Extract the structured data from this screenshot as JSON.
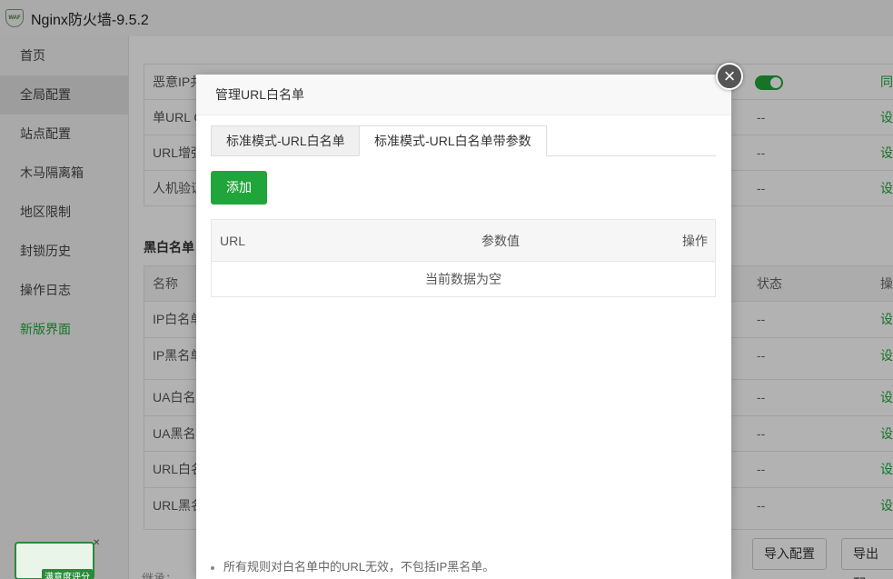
{
  "app": {
    "title": "Nginx防火墙-9.5.2",
    "logo_text": "WAF"
  },
  "sidebar": {
    "items": [
      {
        "label": "首页"
      },
      {
        "label": "全局配置"
      },
      {
        "label": "站点配置"
      },
      {
        "label": "木马隔离箱"
      },
      {
        "label": "地区限制"
      },
      {
        "label": "封锁历史"
      },
      {
        "label": "操作日志"
      },
      {
        "label": "新版界面"
      }
    ]
  },
  "background": {
    "rows_top": [
      {
        "name": "恶意IP共",
        "status": "",
        "op": "同"
      },
      {
        "name": "单URL C",
        "status": "--",
        "op": "设"
      },
      {
        "name": "URL增强",
        "status": "--",
        "op": "设"
      },
      {
        "name": "人机验证",
        "status": "--",
        "op": "设"
      }
    ],
    "section": "黑白名单",
    "list_header": {
      "name": "名称",
      "status": "状态",
      "op": "操"
    },
    "rows_list": [
      {
        "name": "IP白名单",
        "status": "--",
        "op": "设"
      },
      {
        "name": "IP黑名单",
        "status": "--",
        "op": "设"
      },
      {
        "name": "UA白名",
        "status": "--",
        "op": "设"
      },
      {
        "name": "UA黑名",
        "status": "--",
        "op": "设"
      },
      {
        "name": "URL白名",
        "status": "--",
        "op": "设"
      },
      {
        "name": "URL黑名",
        "status": "--",
        "op": "设"
      }
    ],
    "import_label": "导入配置",
    "export_label": "导出配",
    "inherit_text": "继承：",
    "rating_label": "满意度评分"
  },
  "modal": {
    "title": "管理URL白名单",
    "close": "×",
    "tabs": [
      {
        "label": "标准模式-URL白名单"
      },
      {
        "label": "标准模式-URL白名单带参数"
      }
    ],
    "add_label": "添加",
    "table": {
      "col_url": "URL",
      "col_param": "参数值",
      "col_op": "操作",
      "empty": "当前数据为空"
    },
    "note": "所有规则对白名单中的URL无效，不包括IP黑名单。"
  }
}
